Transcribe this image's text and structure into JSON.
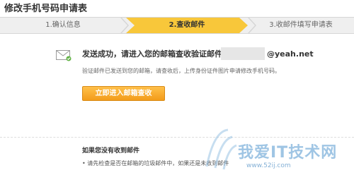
{
  "page": {
    "title": "修改手机号码申请表"
  },
  "steps": [
    {
      "label": "1.确认信息"
    },
    {
      "label": "2.查收邮件"
    },
    {
      "label": "3.收邮件填写申请表"
    }
  ],
  "message": {
    "headline": "发送成功，请进入您的邮箱查收验证邮件",
    "email_domain": "@yeah.net",
    "subtext": "验证邮件已发送到您的邮箱，请查收后，上传身份证件图片申请修改手机号码。"
  },
  "actions": {
    "enter_mail_label": "立即进入邮箱查收"
  },
  "help": {
    "title": "如果您没有收到邮件",
    "line1": "• 请先检查是否在邮箱的垃圾邮件中，如果还是未收到邮件"
  },
  "watermark": {
    "text": "我爱IT技术网",
    "url": "www.52ij.com"
  },
  "colors": {
    "active_step": "#f8c73a",
    "button": "#f39c1a",
    "watermark": "#7fb2dc"
  },
  "icons": {
    "envelope": "envelope-icon",
    "watermark_logo": "watermark-logo-icon"
  }
}
